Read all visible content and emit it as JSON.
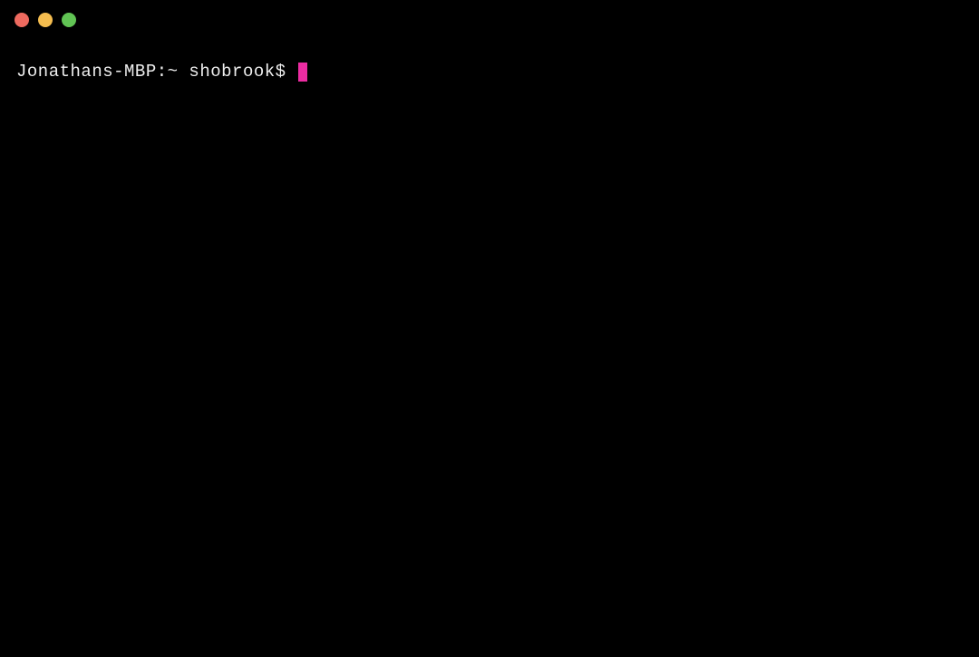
{
  "window": {
    "close_label": "close",
    "minimize_label": "minimize",
    "zoom_label": "zoom"
  },
  "terminal": {
    "prompt": "Jonathans-MBP:~ shobrook$ ",
    "cursor_color": "#ec2ca2"
  }
}
